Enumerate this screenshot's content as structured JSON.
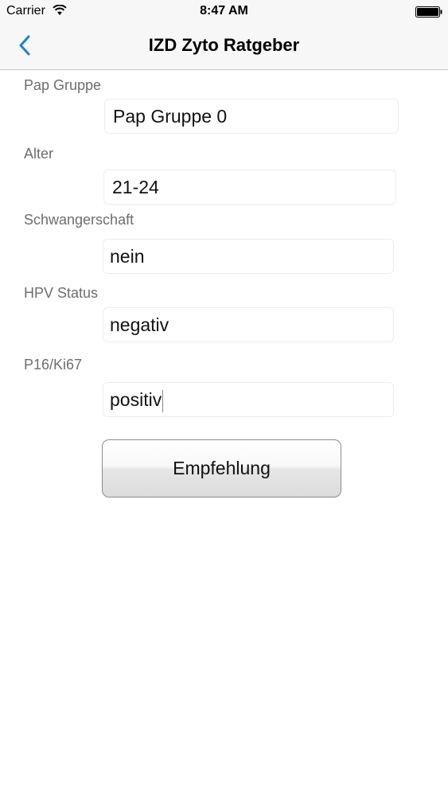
{
  "status_bar": {
    "carrier": "Carrier",
    "time": "8:47 AM"
  },
  "nav": {
    "title": "IZD Zyto Ratgeber",
    "back_icon": "chevron-left-icon",
    "accent_color": "#1a82d6"
  },
  "form": {
    "pap_gruppe": {
      "label": "Pap Gruppe",
      "value": "Pap Gruppe 0"
    },
    "alter": {
      "label": "Alter",
      "value": "21-24"
    },
    "schwangerschaft": {
      "label": "Schwangerschaft",
      "value": "nein"
    },
    "hpv_status": {
      "label": "HPV Status",
      "value": "negativ"
    },
    "p16_ki67": {
      "label": "P16/Ki67",
      "value": "positiv"
    }
  },
  "actions": {
    "empfehlung_label": "Empfehlung"
  }
}
